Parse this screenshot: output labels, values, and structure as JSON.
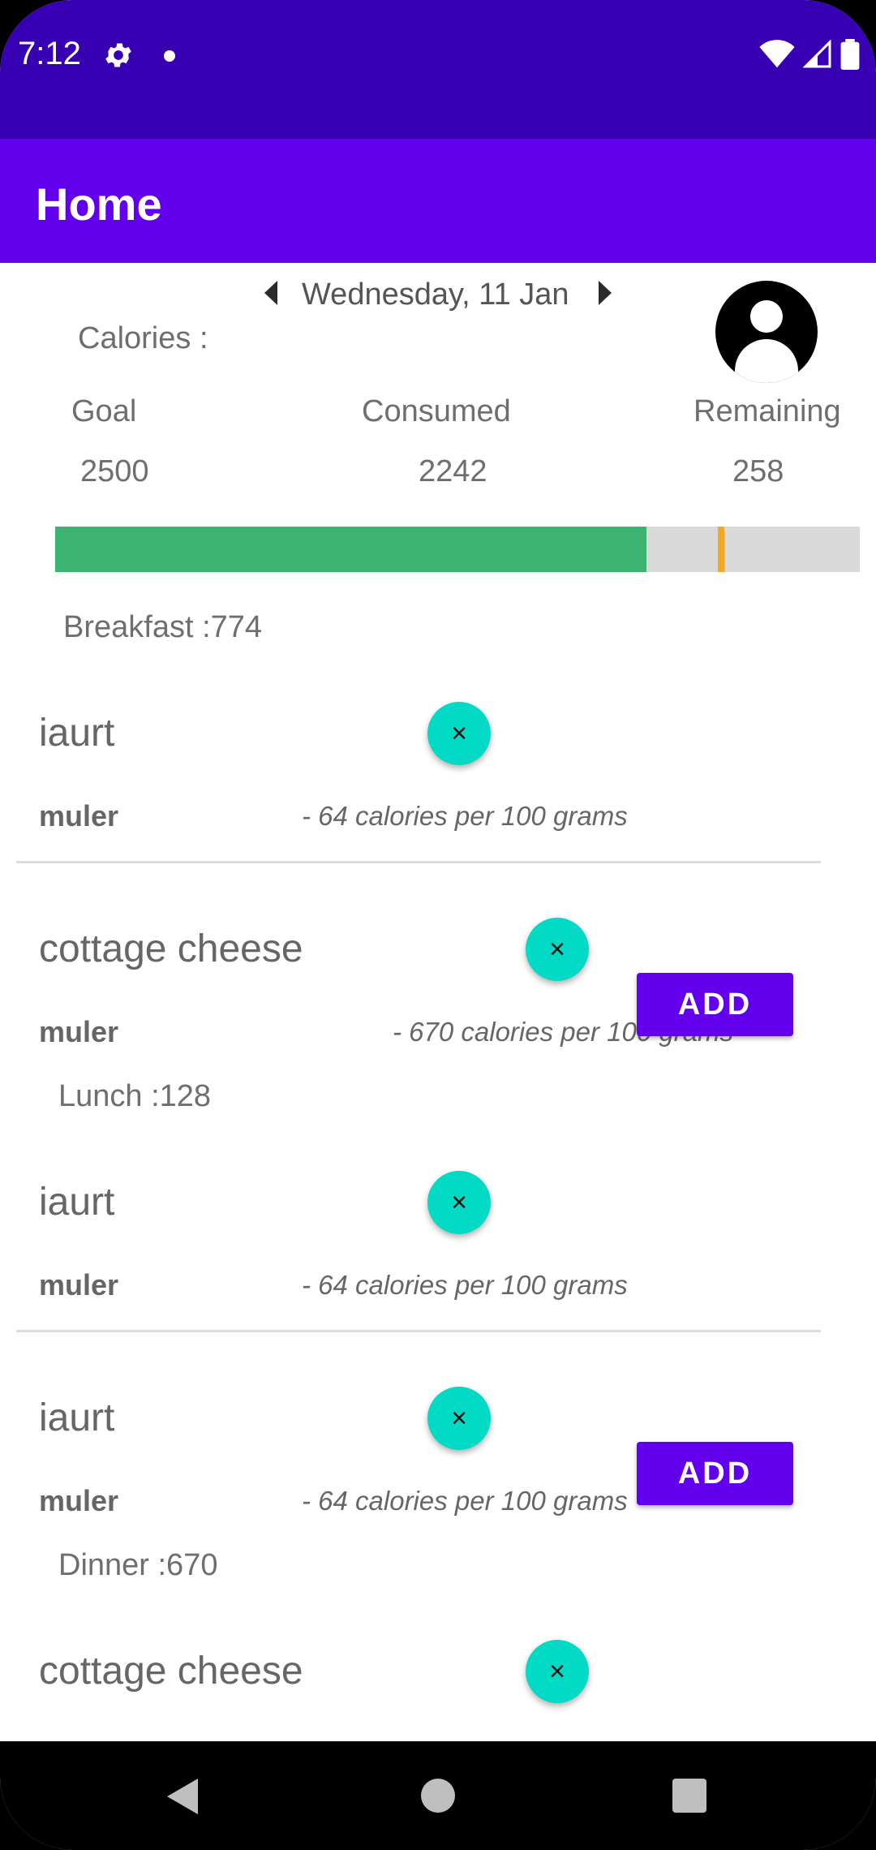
{
  "status_bar": {
    "time": "7:12",
    "icons": [
      "gear-icon",
      "notification-dot-icon",
      "wifi-icon",
      "signal-icon",
      "battery-icon"
    ]
  },
  "app_bar": {
    "title": "Home"
  },
  "date_nav": {
    "date": "Wednesday, 11 Jan"
  },
  "summary": {
    "calories_label": "Calories :",
    "goal_label": "Goal",
    "goal_value": "2500",
    "consumed_label": "Consumed",
    "consumed_value": "2242",
    "remaining_label": "Remaining",
    "remaining_value": "258",
    "progress_fraction": 0.7345
  },
  "sections": {
    "breakfast": "Breakfast :774",
    "lunch": "Lunch :128",
    "dinner": "Dinner :670"
  },
  "items": [
    {
      "name": "iaurt",
      "brand": "muler",
      "calories": "- 64 calories per 100 grams"
    },
    {
      "name": "cottage cheese",
      "brand": "muler",
      "calories": "- 670 calories per 100 grams"
    },
    {
      "name": "iaurt",
      "brand": "muler",
      "calories": "- 64 calories per 100 grams"
    },
    {
      "name": "iaurt",
      "brand": "muler",
      "calories": "- 64 calories per 100 grams"
    },
    {
      "name": "cottage cheese"
    }
  ],
  "buttons": {
    "remove": "×",
    "add": "ADD"
  },
  "colors": {
    "status_bar": "#3700b3",
    "app_bar": "#6200ee",
    "accent": "#03dac5",
    "progress": "#3cb371",
    "marker": "#f5a623"
  }
}
